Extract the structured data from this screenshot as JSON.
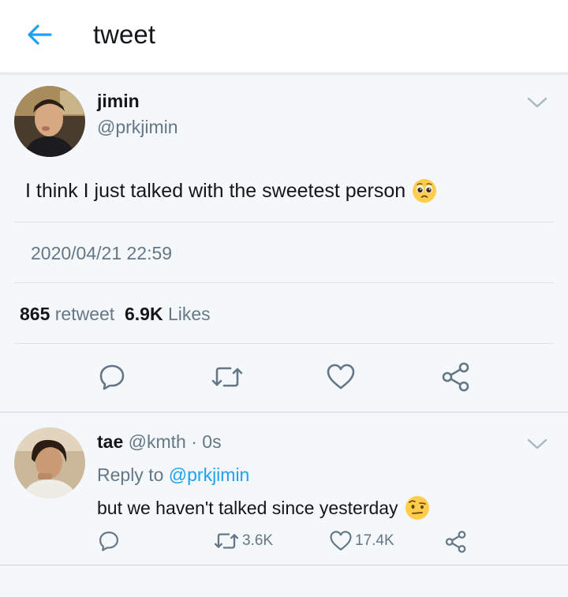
{
  "header": {
    "title": "tweet",
    "back_icon": "arrow-left-icon",
    "accent": "#1da1f2"
  },
  "tweet": {
    "name": "jimin",
    "handle": "@prkjimin",
    "text": "I think I just talked with the sweetest person",
    "emoji": "pleading-face-emoji",
    "timestamp": "2020/04/21 22:59",
    "retweet_count": "865",
    "retweet_label": "retweet",
    "like_count": "6.9K",
    "like_label": "Likes",
    "actions": [
      "reply-icon",
      "retweet-icon",
      "heart-icon",
      "share-icon"
    ]
  },
  "reply": {
    "name": "tae",
    "handle": "@kmth",
    "separator": "·",
    "time": "0s",
    "reply_to_label": "Reply to",
    "reply_to_handle": "@prkjimin",
    "text": "but we haven't talked since yesterday",
    "emoji": "face-with-raised-eyebrow-emoji",
    "retweet_count": "3.6K",
    "like_count": "17.4K"
  },
  "colors": {
    "text": "#14171a",
    "muted": "#657786",
    "background": "#f5f8fa"
  }
}
